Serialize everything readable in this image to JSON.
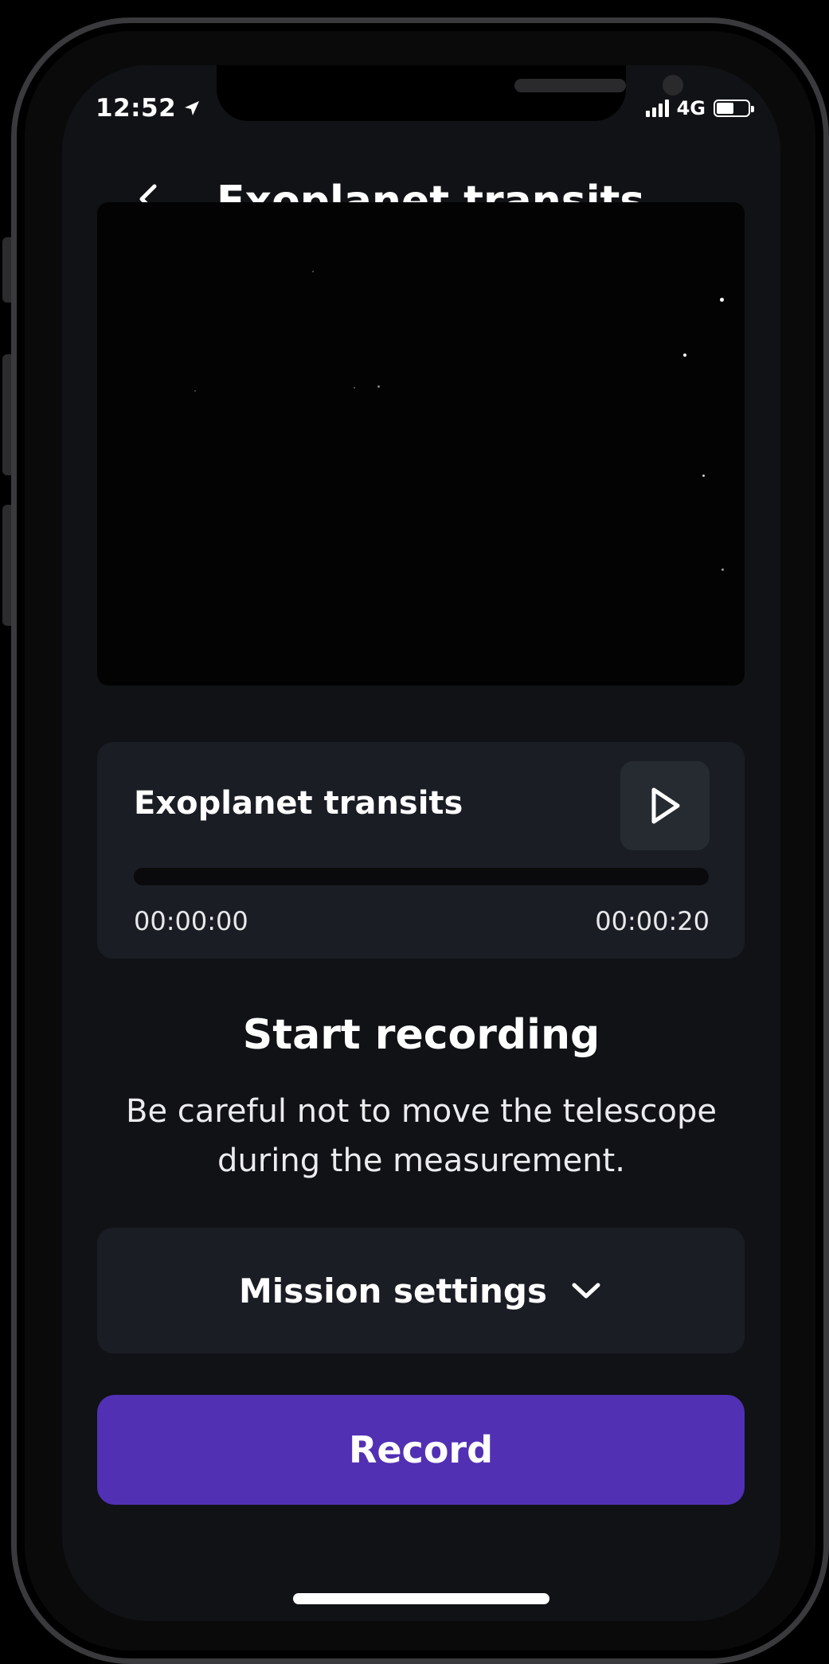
{
  "status_bar": {
    "time": "12:52",
    "network": "4G",
    "battery_level": 0.55,
    "location_icon": "location-arrow-icon"
  },
  "header": {
    "title": "Exoplanet transits",
    "back_icon": "chevron-left-icon"
  },
  "player": {
    "title": "Exoplanet transits",
    "current_time": "00:00:00",
    "total_time": "00:00:20",
    "progress": 0,
    "play_icon": "play-icon"
  },
  "instructions": {
    "title": "Start recording",
    "description": "Be careful not to move the telescope during the measurement."
  },
  "settings": {
    "label": "Mission settings",
    "icon": "chevron-down-icon"
  },
  "record": {
    "label": "Record"
  },
  "colors": {
    "accent": "#5230b3",
    "background": "#101216",
    "card": "#1a1d24"
  }
}
